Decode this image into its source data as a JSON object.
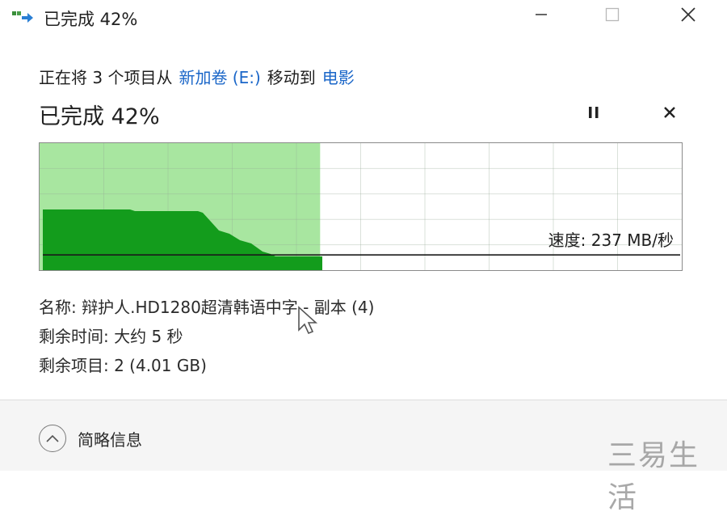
{
  "window": {
    "title": "已完成 42%",
    "controls": {
      "minimize": "minimize",
      "maximize": "maximize",
      "close": "close"
    }
  },
  "operation": {
    "prefix": "正在将 3 个项目从",
    "source": "新加卷 (E:)",
    "verb": "移动到",
    "destination": "电影"
  },
  "progress": {
    "heading": "已完成 42%",
    "percent": 42
  },
  "graph": {
    "speed_label": "速度: 237 MB/秒",
    "speed_level_fraction": 0.26
  },
  "details": {
    "name": "名称: 辩护人.HD1280超清韩语中字 - 副本 (4)",
    "time_remaining": "剩余时间: 大约 5 秒",
    "items_remaining": "剩余项目: 2 (4.01 GB)"
  },
  "footer": {
    "toggle_label": "简略信息"
  },
  "watermark": "三易生活",
  "colors": {
    "progress_fill": "#a8e6a0",
    "speed_fill": "#139c1c",
    "link": "#1a66c8"
  },
  "icons": {
    "app": "move-files-icon",
    "pause": "pause-icon",
    "cancel": "close-icon",
    "toggle": "chevron-up-icon"
  }
}
